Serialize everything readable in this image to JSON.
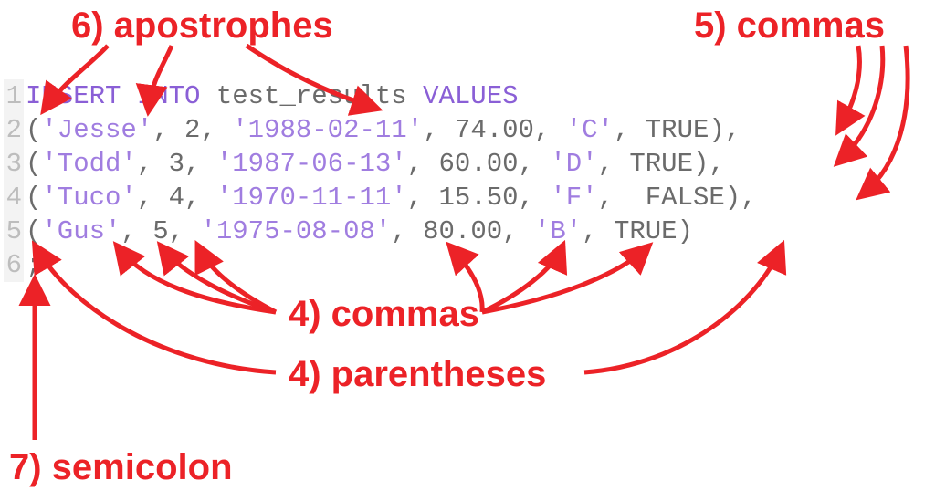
{
  "annotations": {
    "apostrophes": "6) apostrophes",
    "commas_right": "5) commas",
    "commas_inner": "4) commas",
    "parentheses": "4) parentheses",
    "semicolon": "7) semicolon"
  },
  "code": {
    "lines": [
      {
        "n": "1",
        "segments": [
          {
            "cls": "kw",
            "t": "INSERT INTO"
          },
          {
            "cls": "punc",
            "t": " "
          },
          {
            "cls": "ident",
            "t": "test_results"
          },
          {
            "cls": "punc",
            "t": " "
          },
          {
            "cls": "kw",
            "t": "VALUES"
          }
        ]
      },
      {
        "n": "2",
        "segments": [
          {
            "cls": "punc",
            "t": "("
          },
          {
            "cls": "strv",
            "t": "'Jesse'"
          },
          {
            "cls": "punc",
            "t": ", "
          },
          {
            "cls": "num",
            "t": "2"
          },
          {
            "cls": "punc",
            "t": ", "
          },
          {
            "cls": "strv",
            "t": "'1988-02-11'"
          },
          {
            "cls": "punc",
            "t": ", "
          },
          {
            "cls": "num",
            "t": "74.00"
          },
          {
            "cls": "punc",
            "t": ", "
          },
          {
            "cls": "strv",
            "t": "'C'"
          },
          {
            "cls": "punc",
            "t": ", "
          },
          {
            "cls": "bool",
            "t": "TRUE"
          },
          {
            "cls": "punc",
            "t": "),"
          }
        ]
      },
      {
        "n": "3",
        "segments": [
          {
            "cls": "punc",
            "t": "("
          },
          {
            "cls": "strv",
            "t": "'Todd'"
          },
          {
            "cls": "punc",
            "t": ", "
          },
          {
            "cls": "num",
            "t": "3"
          },
          {
            "cls": "punc",
            "t": ", "
          },
          {
            "cls": "strv",
            "t": "'1987-06-13'"
          },
          {
            "cls": "punc",
            "t": ", "
          },
          {
            "cls": "num",
            "t": "60.00"
          },
          {
            "cls": "punc",
            "t": ", "
          },
          {
            "cls": "strv",
            "t": "'D'"
          },
          {
            "cls": "punc",
            "t": ", "
          },
          {
            "cls": "bool",
            "t": "TRUE"
          },
          {
            "cls": "punc",
            "t": "),"
          }
        ]
      },
      {
        "n": "4",
        "segments": [
          {
            "cls": "punc",
            "t": "("
          },
          {
            "cls": "strv",
            "t": "'Tuco'"
          },
          {
            "cls": "punc",
            "t": ", "
          },
          {
            "cls": "num",
            "t": "4"
          },
          {
            "cls": "punc",
            "t": ", "
          },
          {
            "cls": "strv",
            "t": "'1970-11-11'"
          },
          {
            "cls": "punc",
            "t": ", "
          },
          {
            "cls": "num",
            "t": "15.50"
          },
          {
            "cls": "punc",
            "t": ", "
          },
          {
            "cls": "strv",
            "t": "'F'"
          },
          {
            "cls": "punc",
            "t": ",  "
          },
          {
            "cls": "bool",
            "t": "FALSE"
          },
          {
            "cls": "punc",
            "t": "),"
          }
        ]
      },
      {
        "n": "5",
        "segments": [
          {
            "cls": "punc",
            "t": "("
          },
          {
            "cls": "strv",
            "t": "'Gus'"
          },
          {
            "cls": "punc",
            "t": ", "
          },
          {
            "cls": "num",
            "t": "5"
          },
          {
            "cls": "punc",
            "t": ", "
          },
          {
            "cls": "strv",
            "t": "'1975-08-08'"
          },
          {
            "cls": "punc",
            "t": ", "
          },
          {
            "cls": "num",
            "t": "80.00"
          },
          {
            "cls": "punc",
            "t": ", "
          },
          {
            "cls": "strv",
            "t": "'B'"
          },
          {
            "cls": "punc",
            "t": ", "
          },
          {
            "cls": "bool",
            "t": "TRUE"
          },
          {
            "cls": "punc",
            "t": ")"
          }
        ]
      },
      {
        "n": "6",
        "segments": [
          {
            "cls": "punc",
            "t": ";"
          }
        ]
      }
    ]
  },
  "colors": {
    "red": "#ec2227",
    "keyword": "#8a5fd6",
    "string": "#a07de0",
    "default": "#6b6b6b",
    "gutter_bg": "#f3f3f3",
    "gutter_fg": "#bdbdbd"
  }
}
